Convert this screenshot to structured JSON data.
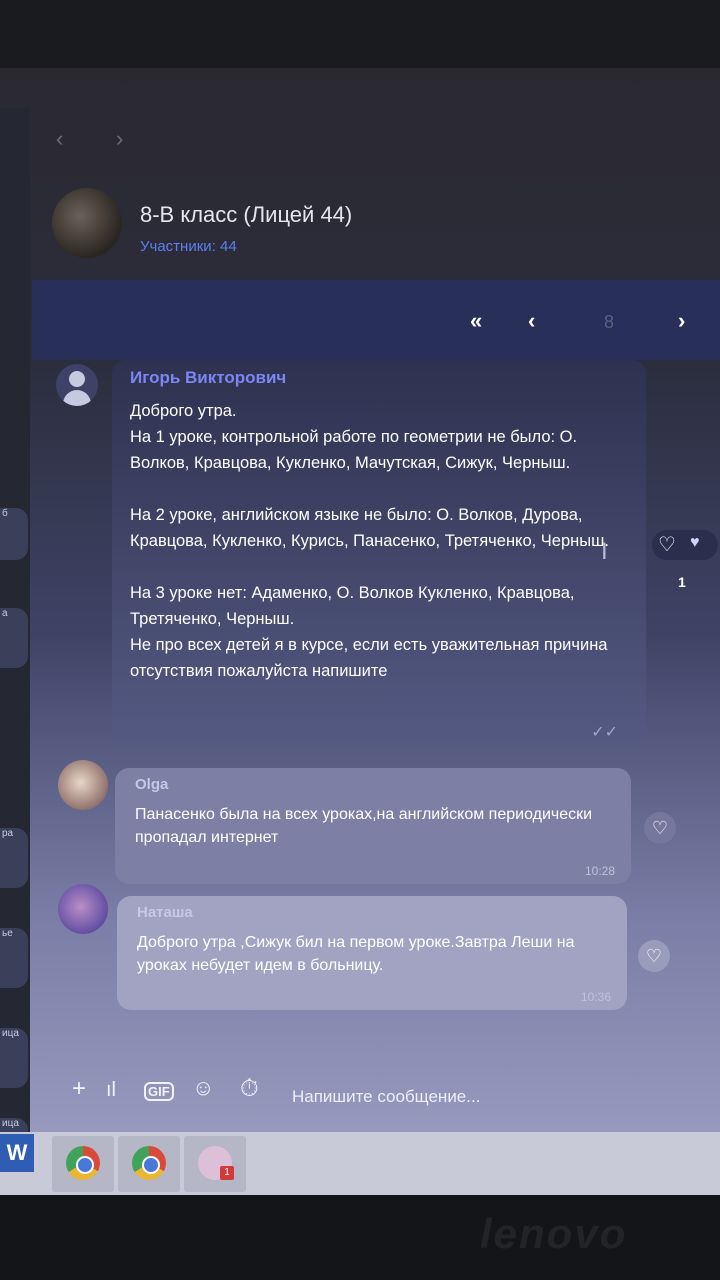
{
  "chat": {
    "title": "8-В класс (Лицей 44)",
    "members": "Участники: 44"
  },
  "pager": {
    "first": "«",
    "prev": "‹",
    "page": "8",
    "next": "›"
  },
  "messages": [
    {
      "author": "Игорь Викторович",
      "text": "Доброго утра.\nНа 1 уроке, контрольной работе по геометрии не было: О. Волков, Кравцова, Кукленко, Мачутская, Сижук, Черныш.\n\nНа 2 уроке, английском языке не было: О. Волков, Дурова, Кравцова, Кукленко, Курись, Панасенко, Третяченко, Черныш.\n\nНа 3 уроке нет: Адаменко, О. Волков Кукленко, Кравцова, Третяченко, Черныш.\nНе про всех детей я в курсе, если есть уважительная причина отсутствия пожалуйста напишите",
      "likes": "1",
      "icon": "user-icon"
    },
    {
      "author": "Olga",
      "text": "Панасенко была на всех уроках,на английском периодически пропадал интернет",
      "time": "10:28"
    },
    {
      "author": "Наташа",
      "text": "Доброго  утра ,Сижук бил на первом уроке.Завтра Леши на уроках небудет идем в больницу.",
      "time": "10:36"
    }
  ],
  "composer": {
    "placeholder": "Напишите сообщение..."
  },
  "sidebar_fragments": [
    "б",
    "а",
    "ра",
    "ье",
    "ица",
    "ица"
  ],
  "taskbar": {
    "word_label": "W",
    "viber_badge": "1",
    "apps": [
      "word-icon",
      "chrome-icon",
      "chrome-icon",
      "viber-icon"
    ]
  },
  "colors": {
    "accent": "#7c86f2",
    "members_link": "#5b7ff0",
    "pager_bg": "#28305a"
  }
}
